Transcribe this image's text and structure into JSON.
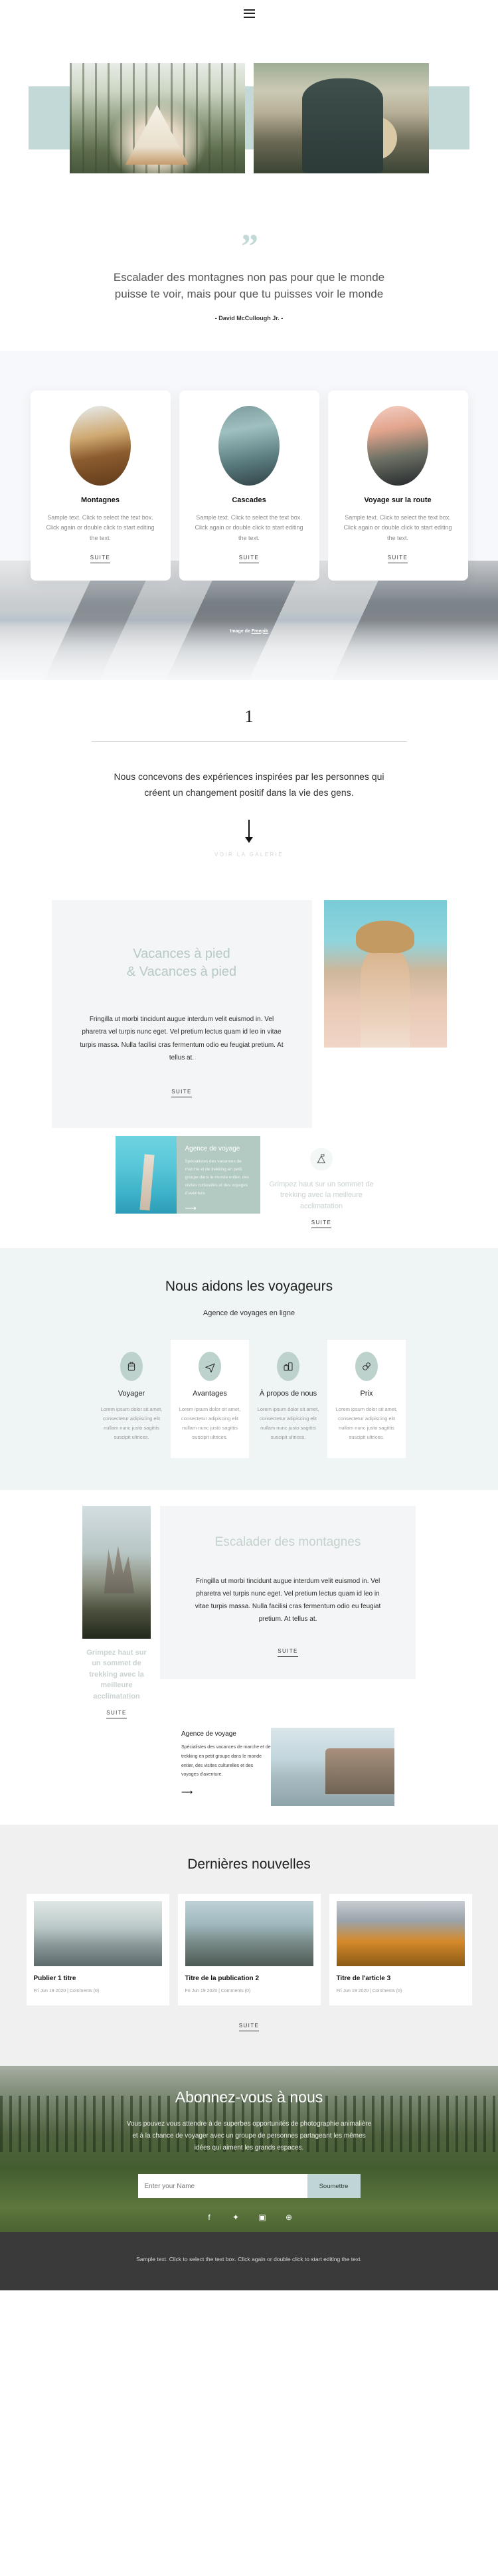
{
  "header": {
    "menu_icon": "hamburger-icon"
  },
  "hero": {
    "image_left_alt": "tent-in-forest",
    "image_right_alt": "man-with-guitar-by-lake"
  },
  "quote": {
    "mark": "”",
    "text": "Escalader des montagnes non pas pour que le monde puisse te voir, mais pour que tu puisses voir le monde",
    "author": "- David McCullough Jr. -"
  },
  "cards_section": {
    "credit": "Image de ",
    "credit_link": "Freepik",
    "cards": [
      {
        "title": "Montagnes",
        "text": "Sample text. Click to select the text box. Click again or double click to start editing the text.",
        "link": "SUITE",
        "image": "mountain-sunset-circle"
      },
      {
        "title": "Cascades",
        "text": "Sample text. Click to select the text box. Click again or double click to start editing the text.",
        "link": "SUITE",
        "image": "waterfall-circle"
      },
      {
        "title": "Voyage sur la route",
        "text": "Sample text. Click to select the text box. Click again or double click to start editing the text.",
        "link": "SUITE",
        "image": "road-trip-circle"
      }
    ]
  },
  "intro": {
    "number": "1",
    "text": "Nous concevons des expériences inspirées par les personnes qui créent un changement positif dans la vie des gens.",
    "arrow": "arrow-down-icon",
    "gallery_link": "VOIR LA GALERIE"
  },
  "vacances": {
    "title": "Vacances à pied\n& Vacances à pied",
    "title_line1": "Vacances à pied",
    "title_line2": "& Vacances à pied",
    "text": "Fringilla ut morbi tincidunt augue interdum velit euismod in. Vel pharetra vel turpis nunc eget. Vel pretium lectus quam id leo in vitae turpis massa. Nulla facilisi cras fermentum odio eu feugiat pretium. At tellus at.",
    "link": "SUITE",
    "image_alt": "woman-with-straw-hat",
    "pier_image_alt": "pier-over-turquoise-water",
    "agency": {
      "title": "Agence de voyage",
      "text": "Spécialistes des vacances de marche et de trekking en petit groupe dans le monde entier, des visites culturelles et des voyages d'aventure.",
      "arrow": "⟶"
    },
    "climb": {
      "icon": "mountain-flag-icon",
      "title": "Grimpez haut sur un sommet de trekking avec la meilleure acclimatation",
      "link": "SUITE"
    }
  },
  "helpers": {
    "heading": "Nous aidons les voyageurs",
    "subheading": "Agence de voyages en ligne",
    "features": [
      {
        "icon": "backpack-icon",
        "title": "Voyager",
        "text": "Lorem ipsum dolor sit amet, consectetur adipiscing elit nullam nunc justo sagittis suscipit ultrices."
      },
      {
        "icon": "airplane-icon",
        "title": "Avantages",
        "text": "Lorem ipsum dolor sit amet, consectetur adipiscing elit nullam nunc justo sagittis suscipit ultrices."
      },
      {
        "icon": "luggage-icon",
        "title": "À propos de nous",
        "text": "Lorem ipsum dolor sit amet, consectetur adipiscing elit nullam nunc justo sagittis suscipit ultrices."
      },
      {
        "icon": "balloon-icon",
        "title": "Prix",
        "text": "Lorem ipsum dolor sit amet, consectetur adipiscing elit nullam nunc justo sagittis suscipit ultrices."
      }
    ]
  },
  "escalader": {
    "title": "Escalader des montagnes",
    "text": "Fringilla ut morbi tincidunt augue interdum velit euismod in. Vel pharetra vel turpis nunc eget. Vel pretium lectus quam id leo in vitae turpis massa. Nulla facilisi cras fermentum odio eu feugiat pretium. At tellus at.",
    "link": "SUITE",
    "image_alt": "rock-spires-mountain",
    "caption_title": "Grimpez haut sur un sommet de trekking avec la meilleure acclimatation",
    "caption_link": "SUITE",
    "agency": {
      "title": "Agence de voyage",
      "text": "Spécialistes des vacances de marche et de trekking en petit groupe dans le monde entier, des visites culturelles et des voyages d'aventure.",
      "arrow": "⟶",
      "image_alt": "coastal-cliff-ocean"
    }
  },
  "news": {
    "heading": "Dernières nouvelles",
    "link": "SUITE",
    "posts": [
      {
        "title": "Publier 1 titre",
        "meta": "Fri Jun 19 2020 |  Comments (0)",
        "image": "misty-mountains"
      },
      {
        "title": "Titre de la publication 2",
        "meta": "Fri Jun 19 2020 |  Comments (0)",
        "image": "ocean-cliffs"
      },
      {
        "title": "Titre de l'article 3",
        "meta": "Fri Jun 19 2020 |  Comments (0)",
        "image": "autumn-forest-mountain"
      }
    ]
  },
  "subscribe": {
    "heading": "Abonnez-vous à nous",
    "text": "Vous pouvez vous attendre à de superbes opportunités de photographie animalière et à la chance de voyager avec un groupe de personnes partageant les mêmes idées qui aiment les grands espaces.",
    "input_placeholder": "Enter your Name",
    "input_value": "",
    "button": "Soumettre",
    "socials": [
      {
        "name": "facebook-icon",
        "glyph": "f"
      },
      {
        "name": "twitter-icon",
        "glyph": "✦"
      },
      {
        "name": "instagram-icon",
        "glyph": "▣"
      },
      {
        "name": "dribbble-icon",
        "glyph": "⊕"
      }
    ]
  },
  "footer": {
    "text": "Sample text. Click to select the text box. Click again or double click to start editing the text."
  },
  "colors": {
    "accent": "#c3d9d7",
    "sage": "#b3cac3",
    "muted_title": "#c9d2d2",
    "dark_footer": "#3a3a3a"
  }
}
